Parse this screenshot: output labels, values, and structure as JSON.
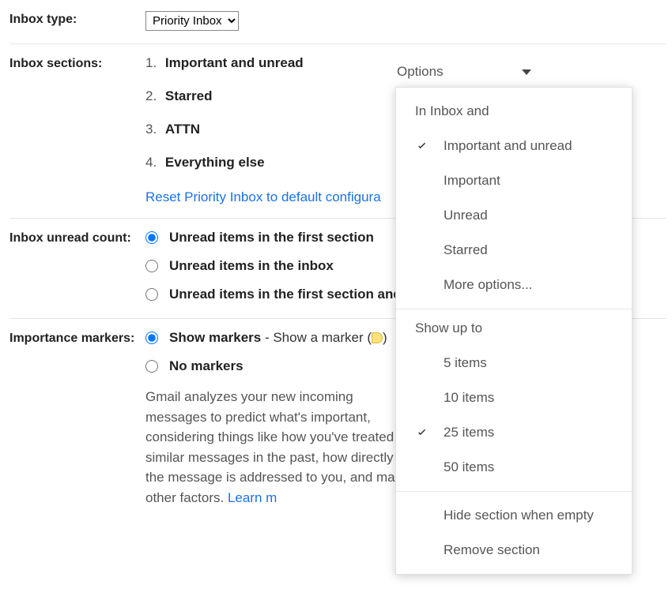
{
  "inbox_type": {
    "label": "Inbox type:",
    "selected": "Priority Inbox"
  },
  "inbox_sections": {
    "label": "Inbox sections:",
    "items": [
      {
        "num": "1.",
        "name": "Important and unread"
      },
      {
        "num": "2.",
        "name": "Starred"
      },
      {
        "num": "3.",
        "name": "ATTN"
      },
      {
        "num": "4.",
        "name": "Everything else"
      }
    ],
    "reset_link": "Reset Priority Inbox to default configura",
    "options_button": "Options"
  },
  "unread_count": {
    "label": "Inbox unread count:",
    "options": [
      {
        "label": "Unread items in the first section",
        "checked": true
      },
      {
        "label": "Unread items in the inbox",
        "checked": false
      },
      {
        "label": "Unread items in the first section and",
        "checked": false
      }
    ]
  },
  "importance_markers": {
    "label": "Importance markers:",
    "show": {
      "label": "Show markers",
      "suffix_before": " - Show a marker (",
      "suffix_after": ")",
      "checked": true
    },
    "no": {
      "label": "No markers",
      "checked": false
    },
    "description": "Gmail analyzes your new incoming messages to predict what's important, considering things like how you've treated similar messages in the past, how directly the message is addressed to you, and many other factors. ",
    "learn_more": "Learn m"
  },
  "options_menu": {
    "group1_header": "In Inbox and",
    "group1": [
      {
        "label": "Important and unread",
        "checked": true
      },
      {
        "label": "Important",
        "checked": false
      },
      {
        "label": "Unread",
        "checked": false
      },
      {
        "label": "Starred",
        "checked": false
      },
      {
        "label": "More options...",
        "checked": false
      }
    ],
    "group2_header": "Show up to",
    "group2": [
      {
        "label": "5 items",
        "checked": false
      },
      {
        "label": "10 items",
        "checked": false
      },
      {
        "label": "25 items",
        "checked": true
      },
      {
        "label": "50 items",
        "checked": false
      }
    ],
    "group3": [
      {
        "label": "Hide section when empty"
      },
      {
        "label": "Remove section"
      }
    ]
  }
}
